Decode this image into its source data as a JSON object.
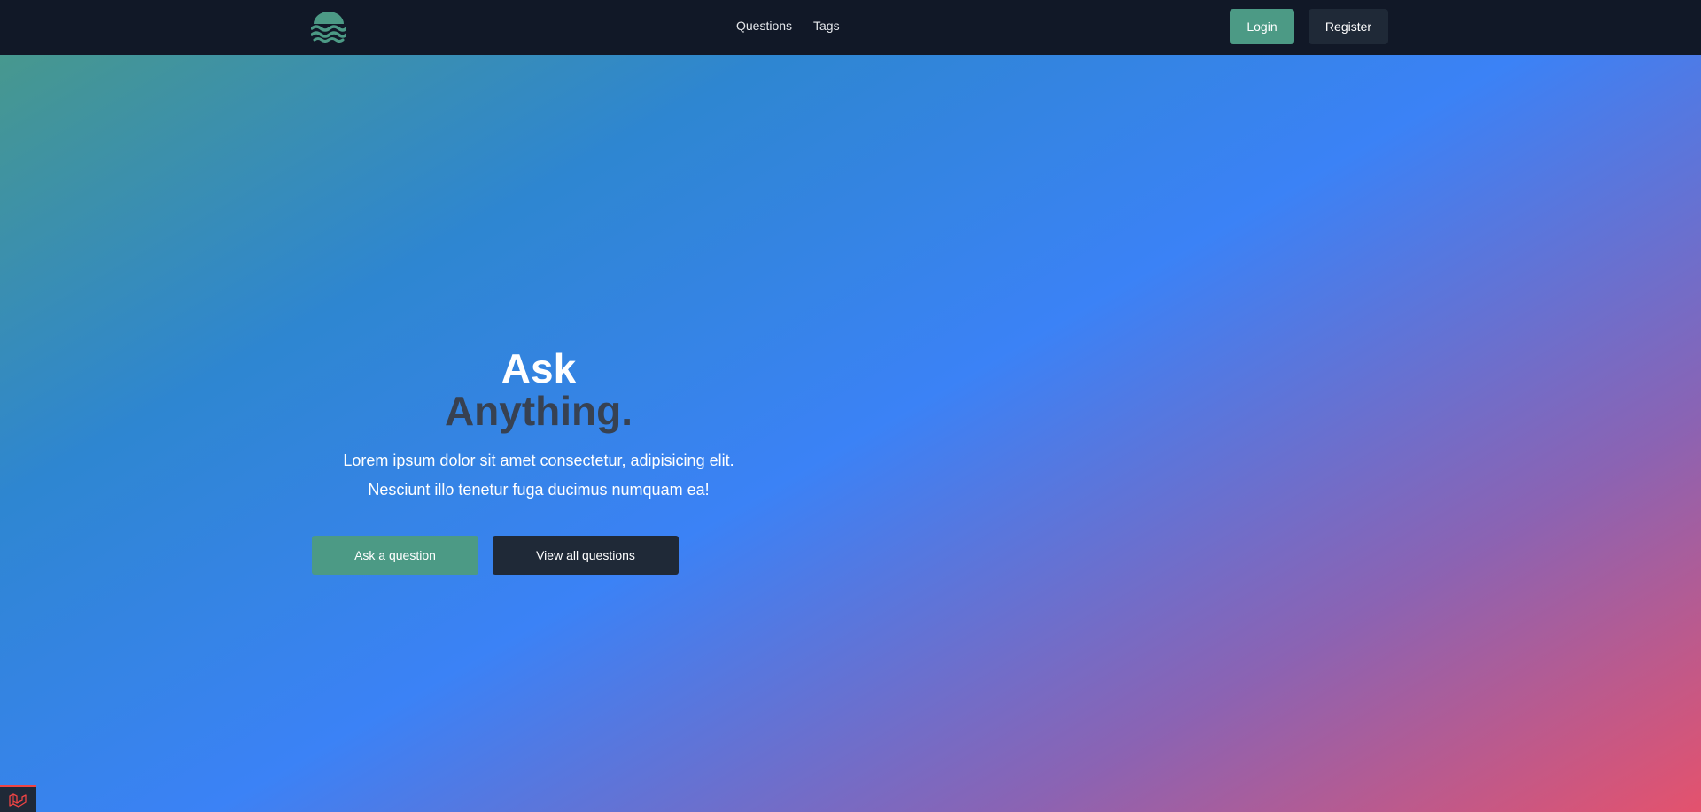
{
  "nav": {
    "links": [
      {
        "label": "Questions"
      },
      {
        "label": "Tags"
      }
    ],
    "login_label": "Login",
    "register_label": "Register",
    "logo_icon": "waves-logo-icon"
  },
  "hero": {
    "title_line1": "Ask",
    "title_line2": "Anything.",
    "subtitle_line1": "Lorem ipsum dolor sit amet consectetur, adipisicing elit.",
    "subtitle_line2": "Nesciunt illo tenetur fuga ducimus numquam ea!",
    "ask_button_label": "Ask a question",
    "view_button_label": "View all questions"
  },
  "debugbar": {
    "icon": "laravel-icon"
  },
  "colors": {
    "navbar_bg": "#111827",
    "accent": "#4c9a85",
    "dark_button": "#1f2937",
    "title_dark": "#374151"
  }
}
